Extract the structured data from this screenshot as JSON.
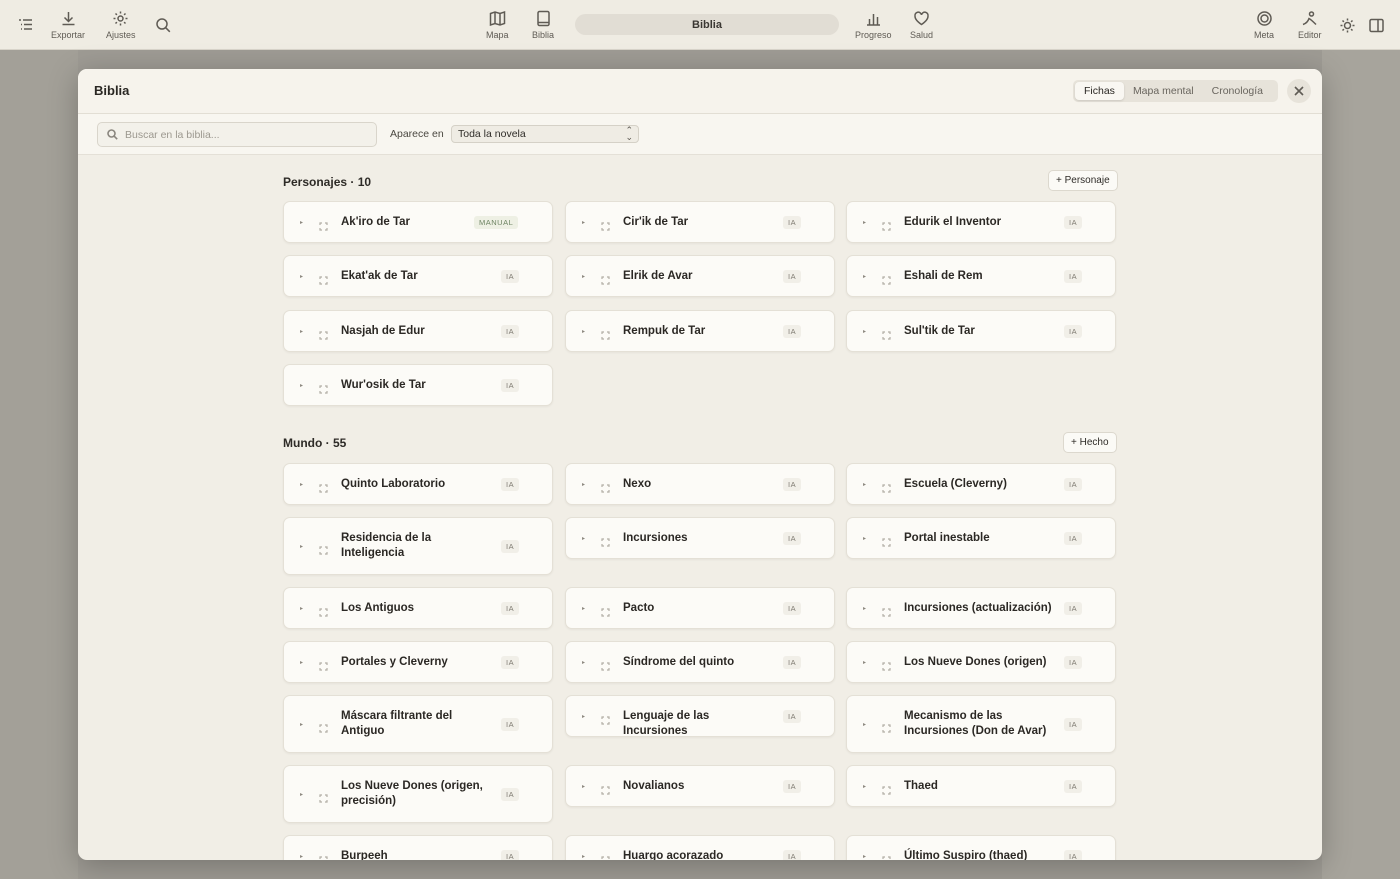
{
  "toolbar": {
    "left_items": [
      {
        "label": "Exportar",
        "icon": "download-icon"
      },
      {
        "label": "Ajustes",
        "icon": "gear-icon"
      }
    ],
    "center_items": [
      {
        "label": "Mapa",
        "icon": "map-icon"
      },
      {
        "label": "Biblia",
        "icon": "book-icon"
      }
    ],
    "center_pill": "Biblia",
    "right_center_items": [
      {
        "label": "Progreso",
        "icon": "bar-chart-icon"
      },
      {
        "label": "Salud",
        "icon": "heart-icon"
      }
    ],
    "right_items": [
      {
        "label": "Meta",
        "icon": "target-icon"
      },
      {
        "label": "Editor",
        "icon": "editor-icon"
      }
    ]
  },
  "modal": {
    "title": "Biblia",
    "tabs": [
      {
        "label": "Fichas",
        "active": true
      },
      {
        "label": "Mapa mental",
        "active": false
      },
      {
        "label": "Cronología",
        "active": false
      }
    ],
    "search_placeholder": "Buscar en la biblia...",
    "appears_label": "Aparece en",
    "appears_value": "Toda la novela"
  },
  "sections": {
    "personajes": {
      "title": "Personajes · 10",
      "add_label": "+ Personaje",
      "cards": [
        {
          "name": "Ak'iro de Tar",
          "badge": "MANUAL"
        },
        {
          "name": "Cir'ik de Tar",
          "badge": "IA"
        },
        {
          "name": "Edurik el Inventor",
          "badge": "IA"
        },
        {
          "name": "Ekat'ak de Tar",
          "badge": "IA"
        },
        {
          "name": "Elrik de Avar",
          "badge": "IA"
        },
        {
          "name": "Eshali de Rem",
          "badge": "IA"
        },
        {
          "name": "Nasjah de Edur",
          "badge": "IA"
        },
        {
          "name": "Rempuk de Tar",
          "badge": "IA"
        },
        {
          "name": "Sul'tik de Tar",
          "badge": "IA"
        },
        {
          "name": "Wur'osik de Tar",
          "badge": "IA"
        }
      ]
    },
    "mundo": {
      "title": "Mundo · 55",
      "add_label": "+ Hecho",
      "cards": [
        {
          "name": "Quinto Laboratorio",
          "badge": "IA"
        },
        {
          "name": "Nexo",
          "badge": "IA"
        },
        {
          "name": "Escuela (Cleverny)",
          "badge": "IA"
        },
        {
          "name": "Residencia de la Inteligencia",
          "badge": "IA"
        },
        {
          "name": "Incursiones",
          "badge": "IA"
        },
        {
          "name": "Portal inestable",
          "badge": "IA"
        },
        {
          "name": "Los Antiguos",
          "badge": "IA"
        },
        {
          "name": "Pacto",
          "badge": "IA"
        },
        {
          "name": "Incursiones (actualización)",
          "badge": "IA"
        },
        {
          "name": "Portales y Cleverny",
          "badge": "IA"
        },
        {
          "name": "Síndrome del quinto",
          "badge": "IA"
        },
        {
          "name": "Los Nueve Dones (origen)",
          "badge": "IA"
        },
        {
          "name": "Máscara filtrante del Antiguo",
          "badge": "IA"
        },
        {
          "name": "Lenguaje de las Incursiones",
          "badge": "IA"
        },
        {
          "name": "Mecanismo de las Incursiones (Don de Avar)",
          "badge": "IA"
        },
        {
          "name": "Los Nueve Dones (origen, precisión)",
          "badge": "IA"
        },
        {
          "name": "Novalianos",
          "badge": "IA"
        },
        {
          "name": "Thaed",
          "badge": "IA"
        },
        {
          "name": "Burpeeh",
          "badge": "IA"
        },
        {
          "name": "Huargo acorazado",
          "badge": "IA"
        },
        {
          "name": "Último Suspiro (thaed)",
          "badge": "IA"
        }
      ]
    }
  }
}
